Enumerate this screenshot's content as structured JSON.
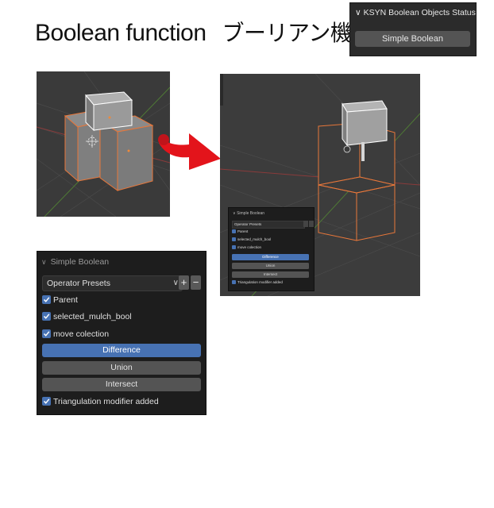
{
  "title": {
    "en": "Boolean function",
    "jp": "ブーリアン機能"
  },
  "status_panel": {
    "header": "KSYN Boolean Objects Status",
    "button": "Simple Boolean"
  },
  "panel": {
    "header": "Simple Boolean",
    "presets": "Operator Presets",
    "plus": "+",
    "minus": "−",
    "checkboxes": [
      {
        "label": "Parent",
        "checked": true
      },
      {
        "label": "selected_mulch_bool",
        "checked": true
      },
      {
        "label": "move colection",
        "checked": true
      }
    ],
    "buttons": [
      {
        "label": "Difference",
        "active": true
      },
      {
        "label": "Union",
        "active": false
      },
      {
        "label": "Intersect",
        "active": false
      }
    ],
    "triangulation": {
      "label": "Triangulation modifier added",
      "checked": true
    }
  },
  "colors": {
    "accent": "#4772b3",
    "panel_bg": "#1d1d1d",
    "arrow": "#e3141b",
    "selection": "#e8773a"
  }
}
